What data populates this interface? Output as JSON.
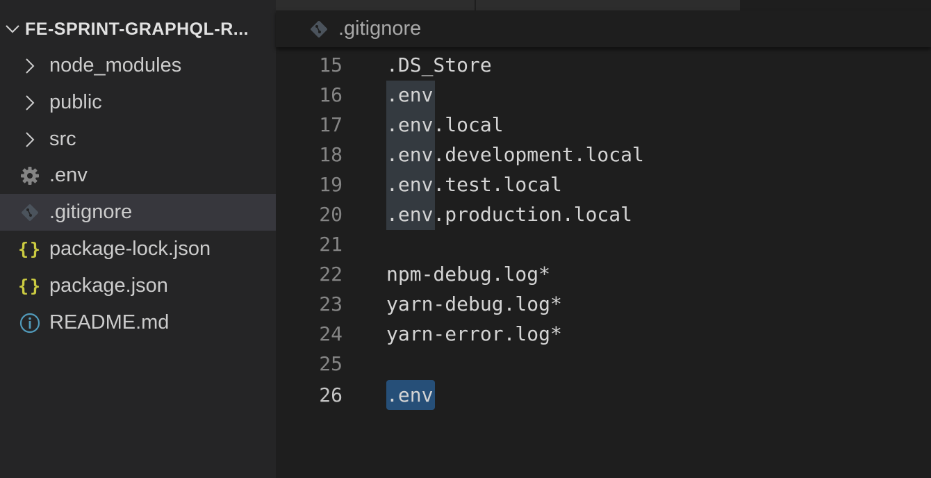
{
  "explorer": {
    "project_title": "FE-SPRINT-GRAPHQL-R...",
    "items": [
      {
        "label": "node_modules",
        "kind": "folder",
        "icon": "chevron-right-icon"
      },
      {
        "label": "public",
        "kind": "folder",
        "icon": "chevron-right-icon"
      },
      {
        "label": "src",
        "kind": "folder",
        "icon": "chevron-right-icon"
      },
      {
        "label": ".env",
        "kind": "file",
        "icon": "gear-icon"
      },
      {
        "label": ".gitignore",
        "kind": "file",
        "icon": "git-icon",
        "selected": true
      },
      {
        "label": "package-lock.json",
        "kind": "file",
        "icon": "json-braces-icon"
      },
      {
        "label": "package.json",
        "kind": "file",
        "icon": "json-braces-icon"
      },
      {
        "label": "README.md",
        "kind": "file",
        "icon": "info-icon"
      }
    ],
    "json_icon_glyph": "{}"
  },
  "editor": {
    "breadcrumb_file": ".gitignore",
    "active_line": 26,
    "lines": [
      {
        "no": "15",
        "text": ".DS_Store"
      },
      {
        "no": "16",
        "text": ".env"
      },
      {
        "no": "17",
        "text": ".env.local"
      },
      {
        "no": "18",
        "text": ".env.development.local"
      },
      {
        "no": "19",
        "text": ".env.test.local"
      },
      {
        "no": "20",
        "text": ".env.production.local"
      },
      {
        "no": "21",
        "text": ""
      },
      {
        "no": "22",
        "text": "npm-debug.log*"
      },
      {
        "no": "23",
        "text": "yarn-debug.log*"
      },
      {
        "no": "24",
        "text": "yarn-error.log*"
      },
      {
        "no": "25",
        "text": ""
      },
      {
        "no": "26",
        "text": ".env"
      }
    ],
    "selected_text": ".env"
  },
  "colors": {
    "sidebar_bg": "#252526",
    "editor_bg": "#1e1e1e",
    "selected_row_bg": "#37373d",
    "selection_bg": "#264f78",
    "occurrence_highlight_bg": "#343a40",
    "json_icon": "#cbcb41",
    "info_icon": "#519aba",
    "gear_icon": "#858585"
  }
}
